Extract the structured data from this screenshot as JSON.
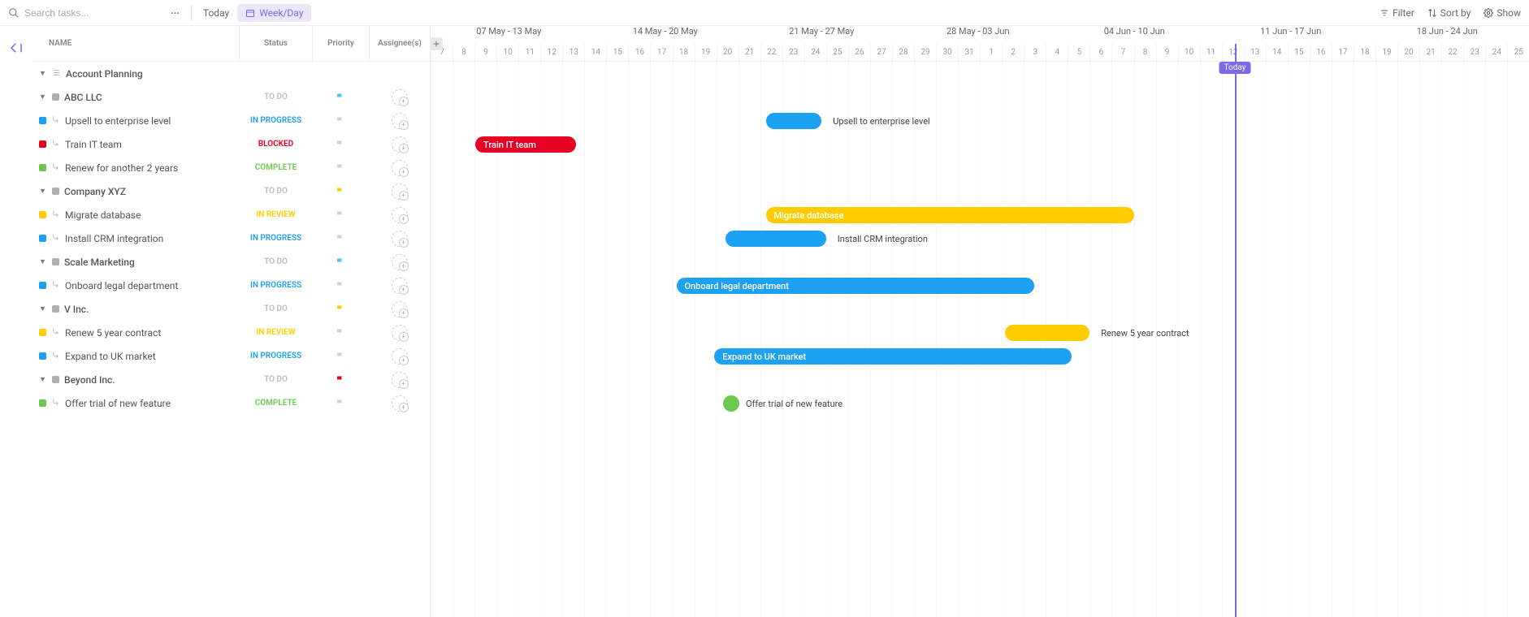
{
  "toolbar": {
    "search_placeholder": "Search tasks...",
    "today": "Today",
    "weekday": "Week/Day",
    "filter": "Filter",
    "sortby": "Sort by",
    "show": "Show"
  },
  "columns": {
    "name": "NAME",
    "status": "Status",
    "priority": "Priority",
    "assignee": "Assignee(s)"
  },
  "statuses": {
    "todo": "TO DO",
    "in_progress": "IN PROGRESS",
    "blocked": "BLOCKED",
    "complete": "COMPLETE",
    "in_review": "IN REVIEW"
  },
  "tree": {
    "root": "Account Planning",
    "groups": [
      {
        "name": "ABC LLC",
        "flag": "blue",
        "items": [
          {
            "name": "Upsell to enterprise level",
            "color": "blue",
            "status": "in_progress"
          },
          {
            "name": "Train IT team",
            "color": "red",
            "status": "blocked"
          },
          {
            "name": "Renew for another 2 years",
            "color": "green",
            "status": "complete"
          }
        ]
      },
      {
        "name": "Company XYZ",
        "flag": "yellow",
        "items": [
          {
            "name": "Migrate database",
            "color": "yellow",
            "status": "in_review"
          },
          {
            "name": "Install CRM integration",
            "color": "blue",
            "status": "in_progress"
          }
        ]
      },
      {
        "name": "Scale Marketing",
        "flag": "blue",
        "items": [
          {
            "name": "Onboard legal department",
            "color": "blue",
            "status": "in_progress"
          }
        ]
      },
      {
        "name": "V Inc.",
        "flag": "yellow",
        "items": [
          {
            "name": "Renew 5 year contract",
            "color": "yellow",
            "status": "in_review"
          },
          {
            "name": "Expand to UK market",
            "color": "blue",
            "status": "in_progress"
          }
        ]
      },
      {
        "name": "Beyond Inc.",
        "flag": "red",
        "items": [
          {
            "name": "Offer trial of new feature",
            "color": "green",
            "status": "complete"
          }
        ]
      }
    ]
  },
  "timeline": {
    "today_label": "Today",
    "weeks": [
      "07 May - 13 May",
      "14 May - 20 May",
      "21 May - 27 May",
      "28 May - 03 Jun",
      "04 Jun - 10 Jun",
      "11 Jun - 17 Jun",
      "18 Jun - 24 Jun"
    ],
    "days": [
      "7",
      "8",
      "9",
      "10",
      "11",
      "12",
      "13",
      "14",
      "15",
      "16",
      "17",
      "18",
      "19",
      "20",
      "21",
      "22",
      "23",
      "24",
      "25",
      "26",
      "27",
      "28",
      "29",
      "30",
      "31",
      "1",
      "2",
      "3",
      "4",
      "5",
      "6",
      "7",
      "8",
      "9",
      "10",
      "11",
      "12",
      "13",
      "14",
      "15",
      "16",
      "17",
      "18",
      "19",
      "20",
      "21",
      "22",
      "23",
      "24",
      "25"
    ],
    "today_index": 36,
    "bars": [
      {
        "label": "Upsell to enterprise level",
        "color": "blue",
        "start": 15,
        "span": 2.5,
        "row": 2,
        "text_inside": false
      },
      {
        "label": "Train IT team",
        "color": "red",
        "start": 2,
        "span": 4.5,
        "row": 3,
        "text_inside": true
      },
      {
        "label": "Migrate database",
        "color": "yellow",
        "start": 15,
        "span": 16.5,
        "row": 6,
        "text_inside": true
      },
      {
        "label": "Install CRM integration",
        "color": "blue",
        "start": 13.2,
        "span": 4.5,
        "row": 7,
        "text_inside": false
      },
      {
        "label": "Onboard legal department",
        "color": "blue",
        "start": 11,
        "span": 16,
        "row": 9,
        "text_inside": true
      },
      {
        "label": "Renew 5 year contract",
        "color": "yellow",
        "start": 25.7,
        "span": 3.8,
        "row": 11,
        "text_inside": false
      },
      {
        "label": "Expand to UK market",
        "color": "blue",
        "start": 12.7,
        "span": 16,
        "row": 12,
        "text_inside": true
      },
      {
        "label": "Offer trial of new feature",
        "color": "green",
        "start": 13.1,
        "span": 0.5,
        "row": 14,
        "text_inside": false
      }
    ]
  }
}
